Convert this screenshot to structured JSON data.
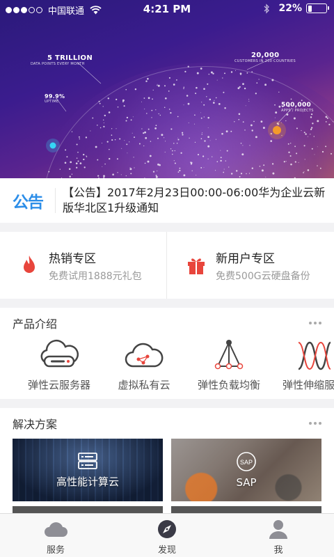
{
  "status_bar": {
    "carrier": "中国联通",
    "time": "4:21 PM",
    "battery": "22%",
    "battery_level": 0.22,
    "signal_bars_filled": 3,
    "signal_bars_total": 5
  },
  "hero": {
    "stats": [
      {
        "value": "5 TRILLION",
        "label": "DATA POINTS EVERY MONTH"
      },
      {
        "value": "20,000",
        "label": "CUSTOMERS IN 200 COUNTRIES"
      },
      {
        "value": "99.9%",
        "label": "UPTIME"
      },
      {
        "value": "500,000",
        "label": "APPS / PROJECTS"
      }
    ],
    "colors": {
      "accent_cyan": "#35d6f5",
      "accent_orange": "#f39a2a"
    }
  },
  "notice": {
    "badge": "公告",
    "text": "【公告】2017年2月23日00:00-06:00华为企业云新版华北区1升级通知",
    "badge_color": "#2d8ee8"
  },
  "promos": [
    {
      "title": "热销专区",
      "subtitle": "免费试用1888元礼包",
      "icon": "flame-icon",
      "color": "#e8453c"
    },
    {
      "title": "新用户专区",
      "subtitle": "免费500G云硬盘备份",
      "icon": "gift-icon",
      "color": "#e8453c"
    }
  ],
  "products": {
    "title": "产品介绍",
    "items": [
      {
        "name": "弹性云服务器",
        "icon": "cloud-server-icon"
      },
      {
        "name": "虚拟私有云",
        "icon": "private-cloud-icon"
      },
      {
        "name": "弹性负载均衡",
        "icon": "load-balancer-icon"
      },
      {
        "name": "弹性伸缩服务",
        "icon": "auto-scaling-icon"
      }
    ]
  },
  "solutions": {
    "title": "解决方案",
    "items": [
      {
        "name": "高性能计算云",
        "icon": "server-rack-icon"
      },
      {
        "name": "SAP",
        "icon": "sap-icon"
      }
    ]
  },
  "tabbar": {
    "items": [
      {
        "label": "服务",
        "icon": "cloud-icon"
      },
      {
        "label": "发现",
        "icon": "compass-icon"
      },
      {
        "label": "我",
        "icon": "user-icon"
      }
    ]
  }
}
